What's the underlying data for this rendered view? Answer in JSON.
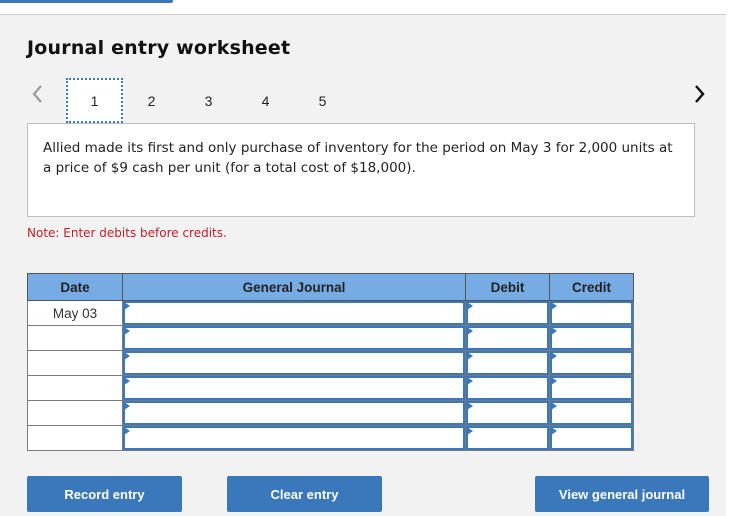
{
  "page": {
    "title": "Journal entry worksheet"
  },
  "nav": {
    "prev_icon": "chevron-left-icon",
    "next_icon": "chevron-right-icon",
    "tabs": [
      {
        "label": "1",
        "active": true
      },
      {
        "label": "2",
        "active": false
      },
      {
        "label": "3",
        "active": false
      },
      {
        "label": "4",
        "active": false
      },
      {
        "label": "5",
        "active": false
      }
    ]
  },
  "scenario": {
    "text": "Allied made its first and only purchase of inventory for the period on May 3 for 2,000 units at a price of $9 cash per unit (for a total cost of $18,000)."
  },
  "note": "Note: Enter debits before credits.",
  "journal": {
    "columns": [
      "Date",
      "General Journal",
      "Debit",
      "Credit"
    ],
    "rows": [
      {
        "date": "May 03",
        "account": "",
        "debit": "",
        "credit": ""
      },
      {
        "date": "",
        "account": "",
        "debit": "",
        "credit": ""
      },
      {
        "date": "",
        "account": "",
        "debit": "",
        "credit": ""
      },
      {
        "date": "",
        "account": "",
        "debit": "",
        "credit": ""
      },
      {
        "date": "",
        "account": "",
        "debit": "",
        "credit": ""
      },
      {
        "date": "",
        "account": "",
        "debit": "",
        "credit": ""
      }
    ]
  },
  "buttons": {
    "record": "Record entry",
    "clear": "Clear entry",
    "view": "View general journal"
  },
  "colors": {
    "accent": "#3a77bb",
    "header_bg": "#77abe4",
    "note": "#c0202a",
    "panel_bg": "#f2f2f2"
  }
}
